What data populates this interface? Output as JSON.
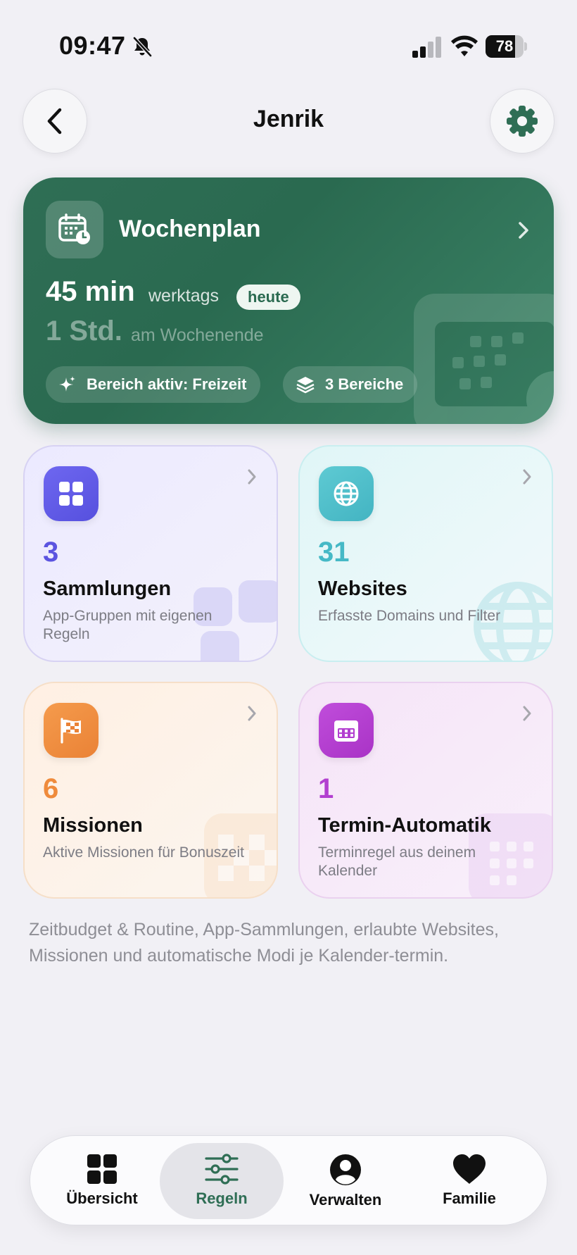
{
  "status": {
    "time": "09:47",
    "battery": "78",
    "battery_level": 0.78,
    "icons": [
      "bell-slash-icon",
      "cellular-signal-icon",
      "wifi-icon",
      "battery-icon"
    ]
  },
  "header": {
    "title": "Jenrik",
    "back_icon": "chevron-left-icon",
    "settings_icon": "gear-icon"
  },
  "plan": {
    "title": "Wochenplan",
    "icon": "calendar-clock-icon",
    "weekday_value": "45 min",
    "weekday_label": "werktags",
    "today_badge": "heute",
    "weekend_value": "1 Std.",
    "weekend_label": "am Wochenende",
    "chip_active": "Bereich aktiv: Freizeit",
    "chip_count": "3 Bereiche",
    "accent": "#2f6e55"
  },
  "tiles": [
    {
      "count": "3",
      "title": "Sammlungen",
      "desc": "App-Gruppen mit eigenen Regeln",
      "icon": "grid-icon",
      "color": "#5b54e0"
    },
    {
      "count": "31",
      "title": "Websites",
      "desc": "Erfasste Domains und Filter",
      "icon": "globe-icon",
      "color": "#46b9c6"
    },
    {
      "count": "6",
      "title": "Missionen",
      "desc": "Aktive Missionen für Bonuszeit",
      "icon": "checkered-flag-icon",
      "color": "#ef8b3c"
    },
    {
      "count": "1",
      "title": "Termin-Automatik",
      "desc": "Terminregel aus deinem Kalender",
      "icon": "calendar-icon",
      "color": "#b23fd0"
    }
  ],
  "footnote": "Zeitbudget & Routine, App-Sammlungen, erlaubte Websites, Missionen und automatische Modi je Kalender-termin.",
  "tabbar": {
    "items": [
      {
        "label": "Übersicht",
        "icon": "grid-icon"
      },
      {
        "label": "Regeln",
        "icon": "sliders-icon",
        "selected": true
      },
      {
        "label": "Verwalten",
        "icon": "person-circle-icon"
      },
      {
        "label": "Familie",
        "icon": "heart-icon"
      }
    ]
  }
}
